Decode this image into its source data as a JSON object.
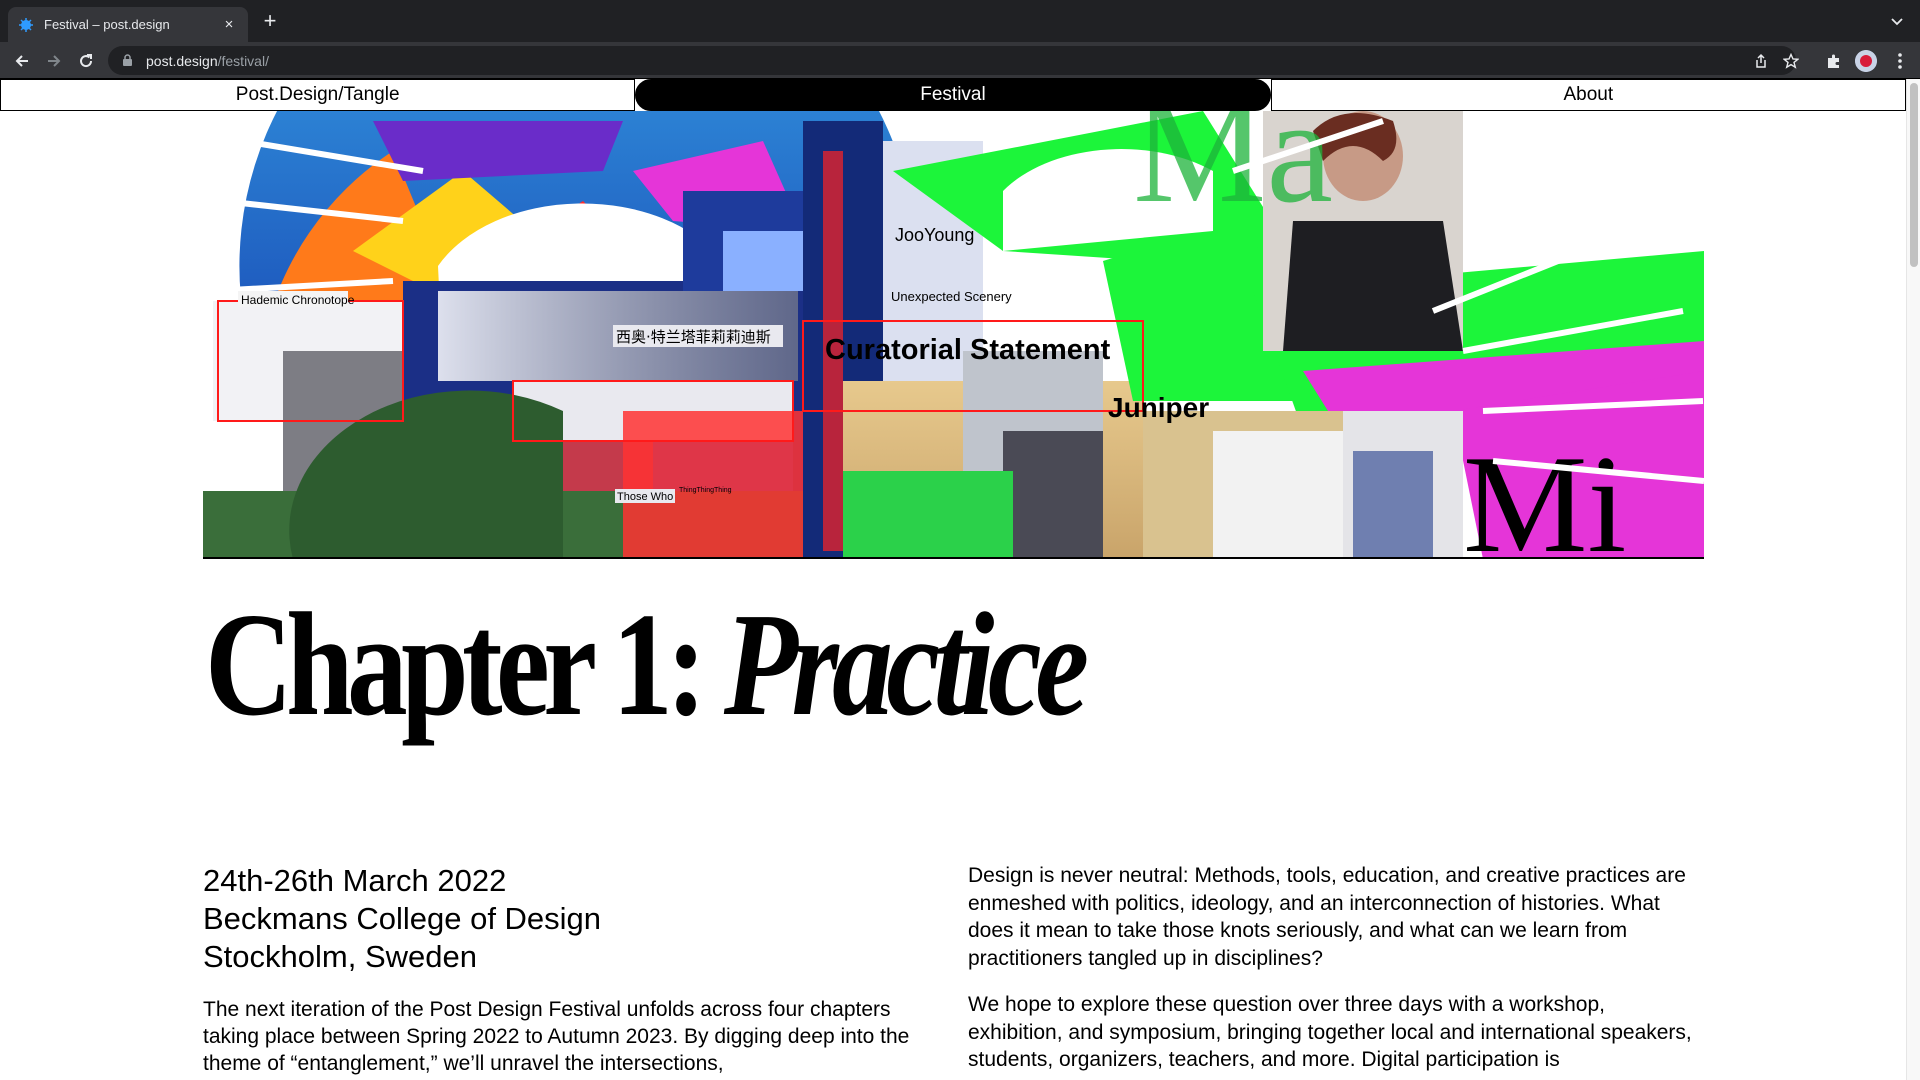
{
  "browser": {
    "tab_title": "Festival – post.design",
    "url_host": "post.design",
    "url_path": "/festival/",
    "new_tab_label": "+",
    "close_label": "×"
  },
  "nav": {
    "items": [
      {
        "label": "Post.Design/Tangle",
        "active": false
      },
      {
        "label": "Festival",
        "active": true
      },
      {
        "label": "About",
        "active": false
      }
    ]
  },
  "hero": {
    "labels": {
      "chronotope": "Hademic Chronotope",
      "chinese": "西奥·特兰塔菲莉莉迪斯",
      "jooyoung": "JooYoung",
      "scenery": "Unexpected Scenery",
      "curatorial": "Curatorial Statement",
      "juniper": "Juniper",
      "those_who": "Those Who",
      "thing": "ThingThingThing"
    },
    "colors": {
      "green": "#1cf53a",
      "magenta": "#e535d8",
      "navy": "#0c1d6b",
      "red": "#ff1a1a"
    }
  },
  "chapter": {
    "prefix": "Chapter 1:",
    "title": "Practice"
  },
  "event": {
    "date": "24th-26th March 2022",
    "venue": "Beckmans College of Design",
    "city": "Stockholm, Sweden"
  },
  "intro": "The next iteration of the Post Design Festival unfolds across four chapters taking place between Spring 2022 to Autumn 2023. By digging deep into the theme of “entanglement,” we’ll unravel the intersections,",
  "statement": {
    "p1": "Design is never neutral: Methods, tools, education, and creative practices are enmeshed with politics, ideology, and an interconnection of histories. What does it mean to take those knots seriously, and what can we learn from practitioners tangled up in disciplines?",
    "p2": "We hope to explore these question over three days with a workshop, exhibition, and symposium, bringing together local and international speakers, students, organizers, teachers, and more. Digital participation is"
  }
}
